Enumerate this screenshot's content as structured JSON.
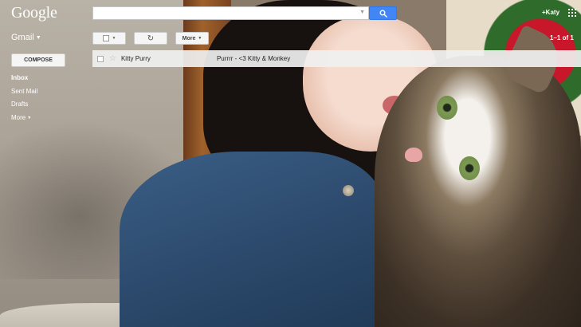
{
  "header": {
    "logo": "Google",
    "search": {
      "value": "",
      "placeholder": ""
    },
    "plus_user": "+Katy",
    "apps_icon": "apps-grid-icon",
    "search_icon": "search-icon"
  },
  "toolbar": {
    "gmail_label": "Gmail",
    "refresh_icon": "refresh-icon",
    "more_label": "More",
    "paging": "1–1 of 1"
  },
  "sidebar": {
    "compose_label": "COMPOSE",
    "items": [
      {
        "label": "Inbox",
        "active": true
      },
      {
        "label": "Sent Mail",
        "active": false
      },
      {
        "label": "Drafts",
        "active": false
      },
      {
        "label": "More",
        "active": false,
        "has_caret": true
      }
    ]
  },
  "messages": [
    {
      "sender": "Kitty Purry",
      "subject": "Purrrr - <3 Kitty & Monkey",
      "starred": false
    }
  ],
  "colors": {
    "search_button": "#4285f4"
  }
}
